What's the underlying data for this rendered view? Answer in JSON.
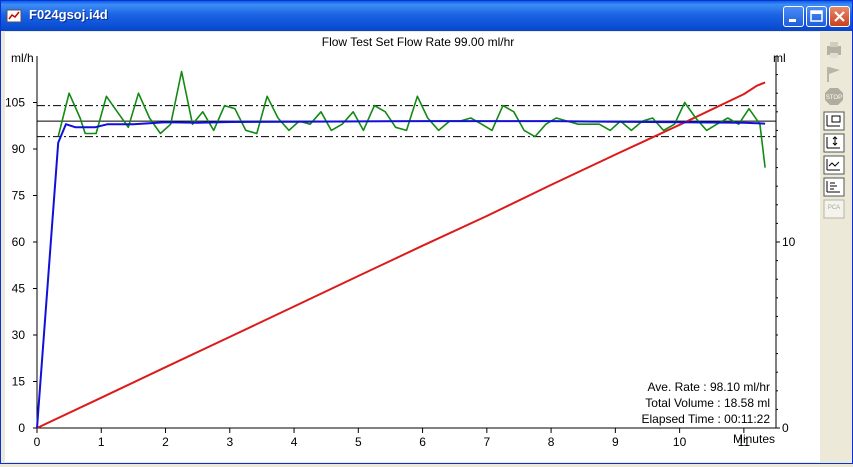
{
  "window": {
    "title": "F024gsoj.i4d",
    "controls": [
      "minimize",
      "maximize",
      "close"
    ]
  },
  "toolbar": {
    "tools": [
      {
        "name": "print-icon",
        "enabled": false
      },
      {
        "name": "flag-icon",
        "enabled": false
      },
      {
        "name": "stop-icon",
        "label": "STOP",
        "enabled": false
      },
      {
        "name": "zoom-window-icon",
        "enabled": true
      },
      {
        "name": "scale-axis-icon",
        "enabled": true
      },
      {
        "name": "chart-settings-icon",
        "enabled": true
      },
      {
        "name": "list-options-icon",
        "enabled": true
      },
      {
        "name": "pca-icon",
        "label": "PCA",
        "enabled": false
      }
    ]
  },
  "chart_data": {
    "type": "line",
    "title": "Flow Test   Set Flow Rate 99.00 ml/hr",
    "y_left_label": "ml/h",
    "y_right_label": "ml",
    "xlabel": "Minutes",
    "xlim": [
      0,
      11.5
    ],
    "ylim_left": [
      0,
      120
    ],
    "ylim_right": [
      0,
      20
    ],
    "x_ticks": [
      "0",
      "1",
      "2",
      "3",
      "4",
      "5",
      "6",
      "7",
      "8",
      "9",
      "10",
      "11"
    ],
    "y_left_ticks": [
      "0",
      "15",
      "30",
      "45",
      "60",
      "75",
      "90",
      "105"
    ],
    "y_right_ticks": [
      "0",
      "10"
    ],
    "reference_lines": [
      {
        "value": 104,
        "style": "dash-dot",
        "axis": "left"
      },
      {
        "value": 99,
        "style": "solid",
        "axis": "left"
      },
      {
        "value": 94,
        "style": "dash-dot",
        "axis": "left"
      }
    ],
    "colors": {
      "instant_rate": "#138A13",
      "average_rate": "#1010D8",
      "volume": "#DD1A1A"
    },
    "series": [
      {
        "axis": "left",
        "color": "#138A13",
        "x": [
          0.33,
          0.5,
          0.67,
          0.75,
          0.92,
          1.08,
          1.25,
          1.42,
          1.58,
          1.75,
          1.92,
          2.08,
          2.25,
          2.42,
          2.58,
          2.75,
          2.92,
          3.08,
          3.25,
          3.42,
          3.58,
          3.75,
          3.92,
          4.08,
          4.25,
          4.42,
          4.58,
          4.75,
          4.92,
          5.08,
          5.25,
          5.42,
          5.58,
          5.75,
          5.92,
          6.08,
          6.25,
          6.42,
          6.58,
          6.75,
          6.92,
          7.08,
          7.25,
          7.42,
          7.58,
          7.75,
          7.92,
          8.08,
          8.25,
          8.42,
          8.58,
          8.75,
          8.92,
          9.08,
          9.25,
          9.42,
          9.58,
          9.75,
          9.92,
          10.08,
          10.25,
          10.42,
          10.58,
          10.75,
          10.92,
          11.08,
          11.25,
          11.33
        ],
        "values": [
          94,
          108,
          100,
          95,
          95,
          107,
          102,
          97,
          108,
          100,
          95,
          98,
          115,
          98,
          102,
          96,
          104,
          103,
          96,
          95,
          107,
          100,
          96,
          99,
          98,
          102,
          96,
          98,
          102,
          96,
          104,
          102,
          97,
          96,
          107,
          100,
          96,
          99,
          99,
          100,
          98,
          96,
          104,
          102,
          96,
          94,
          98,
          100,
          99,
          98,
          98,
          98,
          96,
          99,
          96,
          99,
          100,
          96,
          98,
          105,
          100,
          96,
          98,
          100,
          98,
          103,
          98,
          84
        ]
      },
      {
        "axis": "left",
        "color": "#1010D8",
        "x": [
          0,
          0.33,
          0.45,
          0.6,
          0.75,
          0.9,
          1.1,
          1.5,
          2.0,
          2.5,
          3.0,
          4.0,
          5.0,
          6.0,
          7.0,
          8.0,
          9.0,
          10.0,
          11.0,
          11.33
        ],
        "values": [
          0,
          92,
          98,
          97,
          97,
          97,
          98,
          98,
          98.6,
          98.5,
          98.7,
          98.8,
          98.9,
          99,
          99,
          99,
          98.8,
          98.6,
          98.5,
          98.2
        ]
      },
      {
        "axis": "right",
        "color": "#DD1A1A",
        "x": [
          0,
          1,
          2,
          3,
          4,
          5,
          6,
          7,
          8,
          9,
          10,
          11,
          11.2,
          11.33
        ],
        "values": [
          0,
          1.63,
          3.27,
          4.9,
          6.53,
          8.17,
          9.8,
          11.4,
          13.07,
          14.7,
          16.3,
          17.95,
          18.4,
          18.58
        ]
      }
    ],
    "stats": [
      {
        "label": "Ave. Rate : 98.10 ml/hr"
      },
      {
        "label": "Total Volume : 18.58 ml"
      },
      {
        "label": "Elapsed Time : 00:11:22"
      }
    ]
  }
}
